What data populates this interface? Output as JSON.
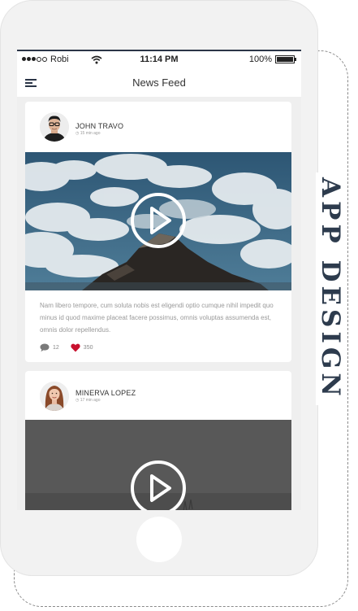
{
  "status_bar": {
    "carrier": "Robi",
    "time": "11:14 PM",
    "battery_percent": "100%",
    "signal_icon": "signal-dots-icon",
    "wifi_icon": "wifi-icon",
    "battery_icon": "battery-full-icon"
  },
  "nav": {
    "title": "News Feed",
    "menu_icon": "hamburger-menu-icon"
  },
  "posts": [
    {
      "author": "JOHN TRAVO",
      "time": "◷ 15 min ago",
      "text": "Nam libero tempore, cum soluta nobis est eligendi optio cumque nihil impedit quo minus id quod maxime placeat facere possimus, omnis voluptas assumenda est, omnis dolor repellendus.",
      "comments": "12",
      "likes": "350",
      "media": "video"
    },
    {
      "author": "MINERVA LOPEZ",
      "time": "◷ 17 min ago",
      "media": "video"
    }
  ],
  "side_caption": "APP DESIGN",
  "colors": {
    "accent": "#2b3547",
    "like": "#c8102e",
    "caption": "#2d3b4d",
    "phone_body": "#f2f2f2"
  }
}
